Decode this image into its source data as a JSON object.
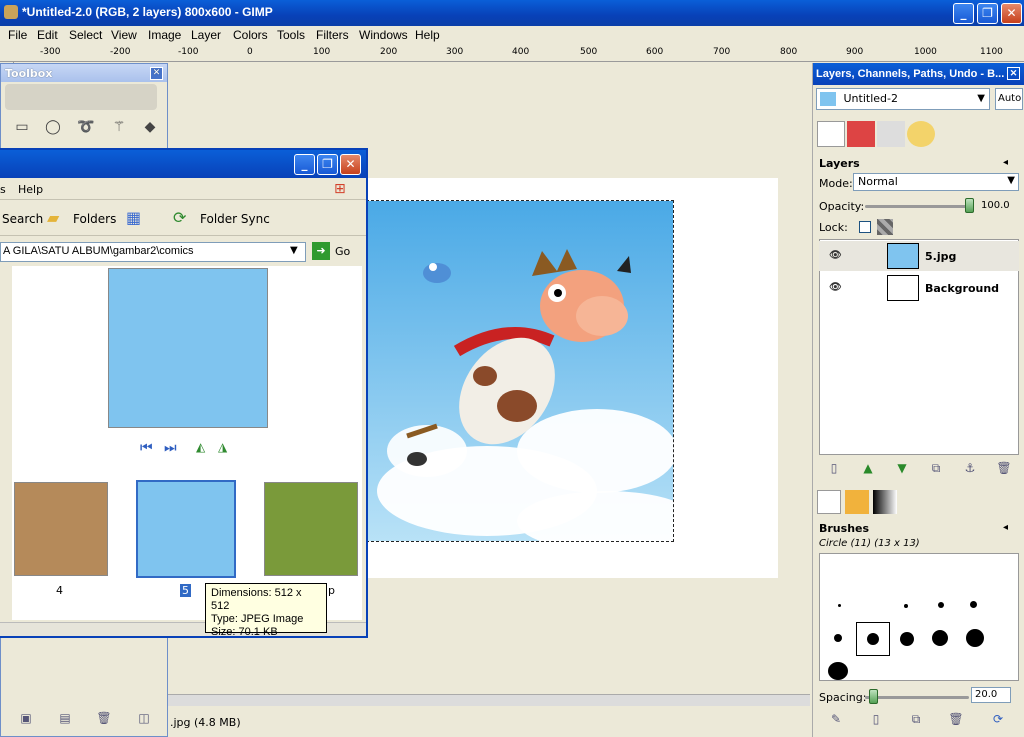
{
  "window": {
    "title": "*Untitled-2.0 (RGB, 2 layers) 800x600 - GIMP",
    "controls": [
      "_",
      "❐",
      "✕"
    ]
  },
  "menubar": [
    "File",
    "Edit",
    "Select",
    "View",
    "Image",
    "Layer",
    "Colors",
    "Tools",
    "Filters",
    "Windows",
    "Help"
  ],
  "ruler": [
    "-300",
    "-200",
    "-100",
    "0",
    "100",
    "200",
    "300",
    "400",
    "500",
    "600",
    "700",
    "800",
    "900",
    "1000",
    "1100"
  ],
  "toolbox": {
    "title": "Toolbox"
  },
  "explorer": {
    "menu": [
      "s",
      "Help"
    ],
    "toolbar": {
      "search": "Search",
      "folders": "Folders",
      "sync": "Folder Sync"
    },
    "address": "A GILA\\SATU ALBUM\\gambar2\\comics",
    "go": "Go",
    "thumbs": [
      {
        "label": "4"
      },
      {
        "label": "5"
      },
      {
        "label": "p"
      }
    ],
    "tooltip": {
      "dimensions": "Dimensions: 512 x 512",
      "type": "Type: JPEG Image",
      "size": "Size: 70.1 KB"
    }
  },
  "status": {
    "text": ".jpg (4.8 MB)"
  },
  "dock": {
    "title": "Layers, Channels, Paths, Undo - B...",
    "image_select": "Untitled-2",
    "auto": "Auto",
    "layers": {
      "title": "Layers",
      "mode_label": "Mode:",
      "mode_value": "Normal",
      "opacity_label": "Opacity:",
      "opacity_value": "100.0",
      "lock_label": "Lock:",
      "items": [
        {
          "name": "5.jpg",
          "selected": true
        },
        {
          "name": "Background",
          "selected": false
        }
      ]
    },
    "brushes": {
      "title": "Brushes",
      "current": "Circle (11) (13 x 13)",
      "spacing_label": "Spacing:",
      "spacing_value": "20.0"
    }
  }
}
